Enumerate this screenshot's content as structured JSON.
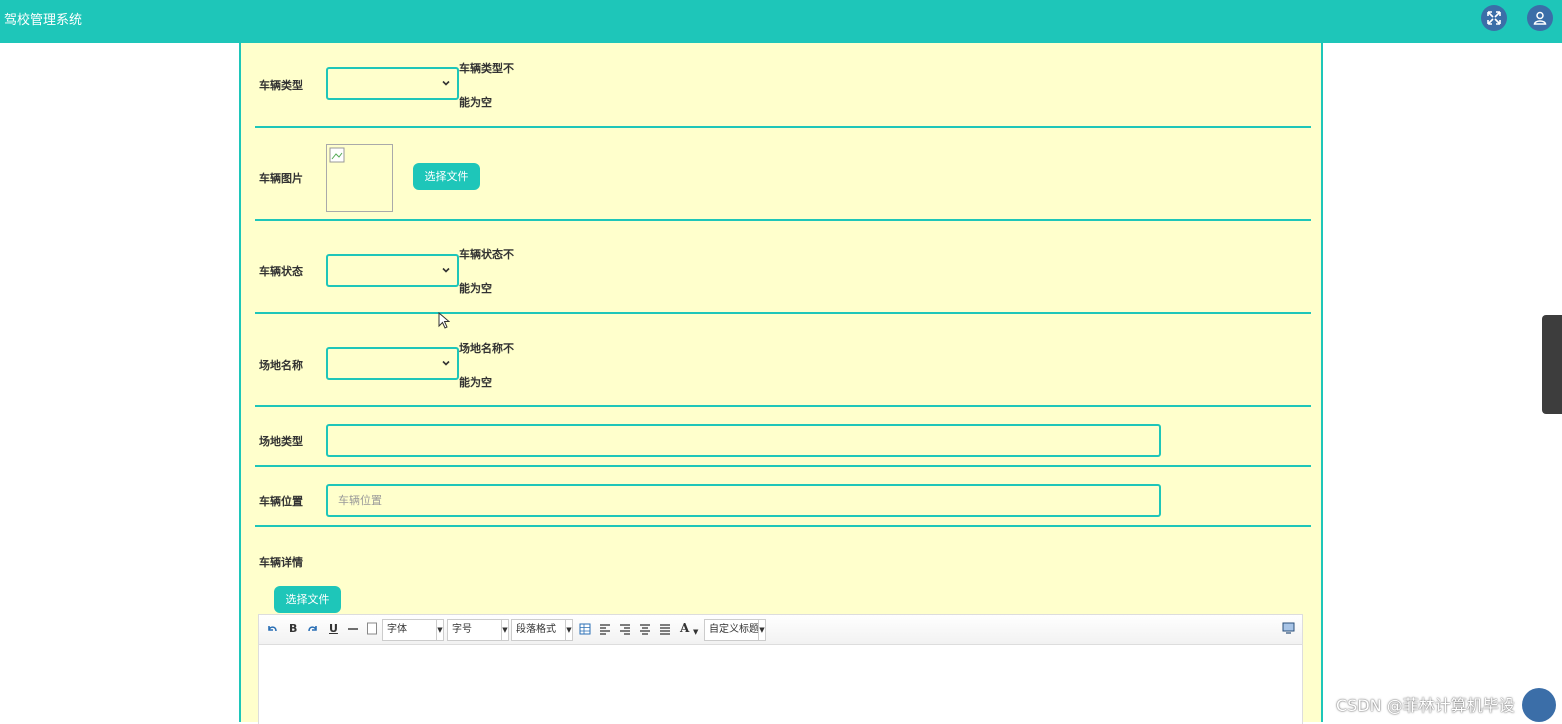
{
  "header": {
    "app_title": "驾校管理系统",
    "fullscreen_icon": "fullscreen-icon",
    "user_icon": "user-icon"
  },
  "form": {
    "vehicle_type": {
      "label": "车辆类型",
      "value": "",
      "error_line1": "车辆类型不",
      "error_line2": "能为空"
    },
    "vehicle_image": {
      "label": "车辆图片",
      "button_label": "选择文件"
    },
    "vehicle_status": {
      "label": "车辆状态",
      "value": "",
      "error_line1": "车辆状态不",
      "error_line2": "能为空"
    },
    "venue_name": {
      "label": "场地名称",
      "value": "",
      "error_line1": "场地名称不",
      "error_line2": "能为空"
    },
    "venue_type": {
      "label": "场地类型",
      "value": ""
    },
    "vehicle_location": {
      "label": "车辆位置",
      "placeholder": "车辆位置",
      "value": ""
    },
    "vehicle_details": {
      "label": "车辆详情",
      "button_label": "选择文件"
    }
  },
  "editor": {
    "toolbar": {
      "undo_icon": "undo-icon",
      "bold": "B",
      "redo_icon": "redo-icon",
      "underline": "U",
      "font_family": "字体",
      "font_size": "字号",
      "paragraph_format": "段落格式",
      "font_color": "A",
      "custom_title": "自定义标题"
    }
  },
  "watermark": "CSDN @菲林计算机毕设",
  "colors": {
    "accent": "#1ec6b9",
    "panel_bg": "#ffffcc",
    "icon_bg": "#3b6ea8"
  }
}
